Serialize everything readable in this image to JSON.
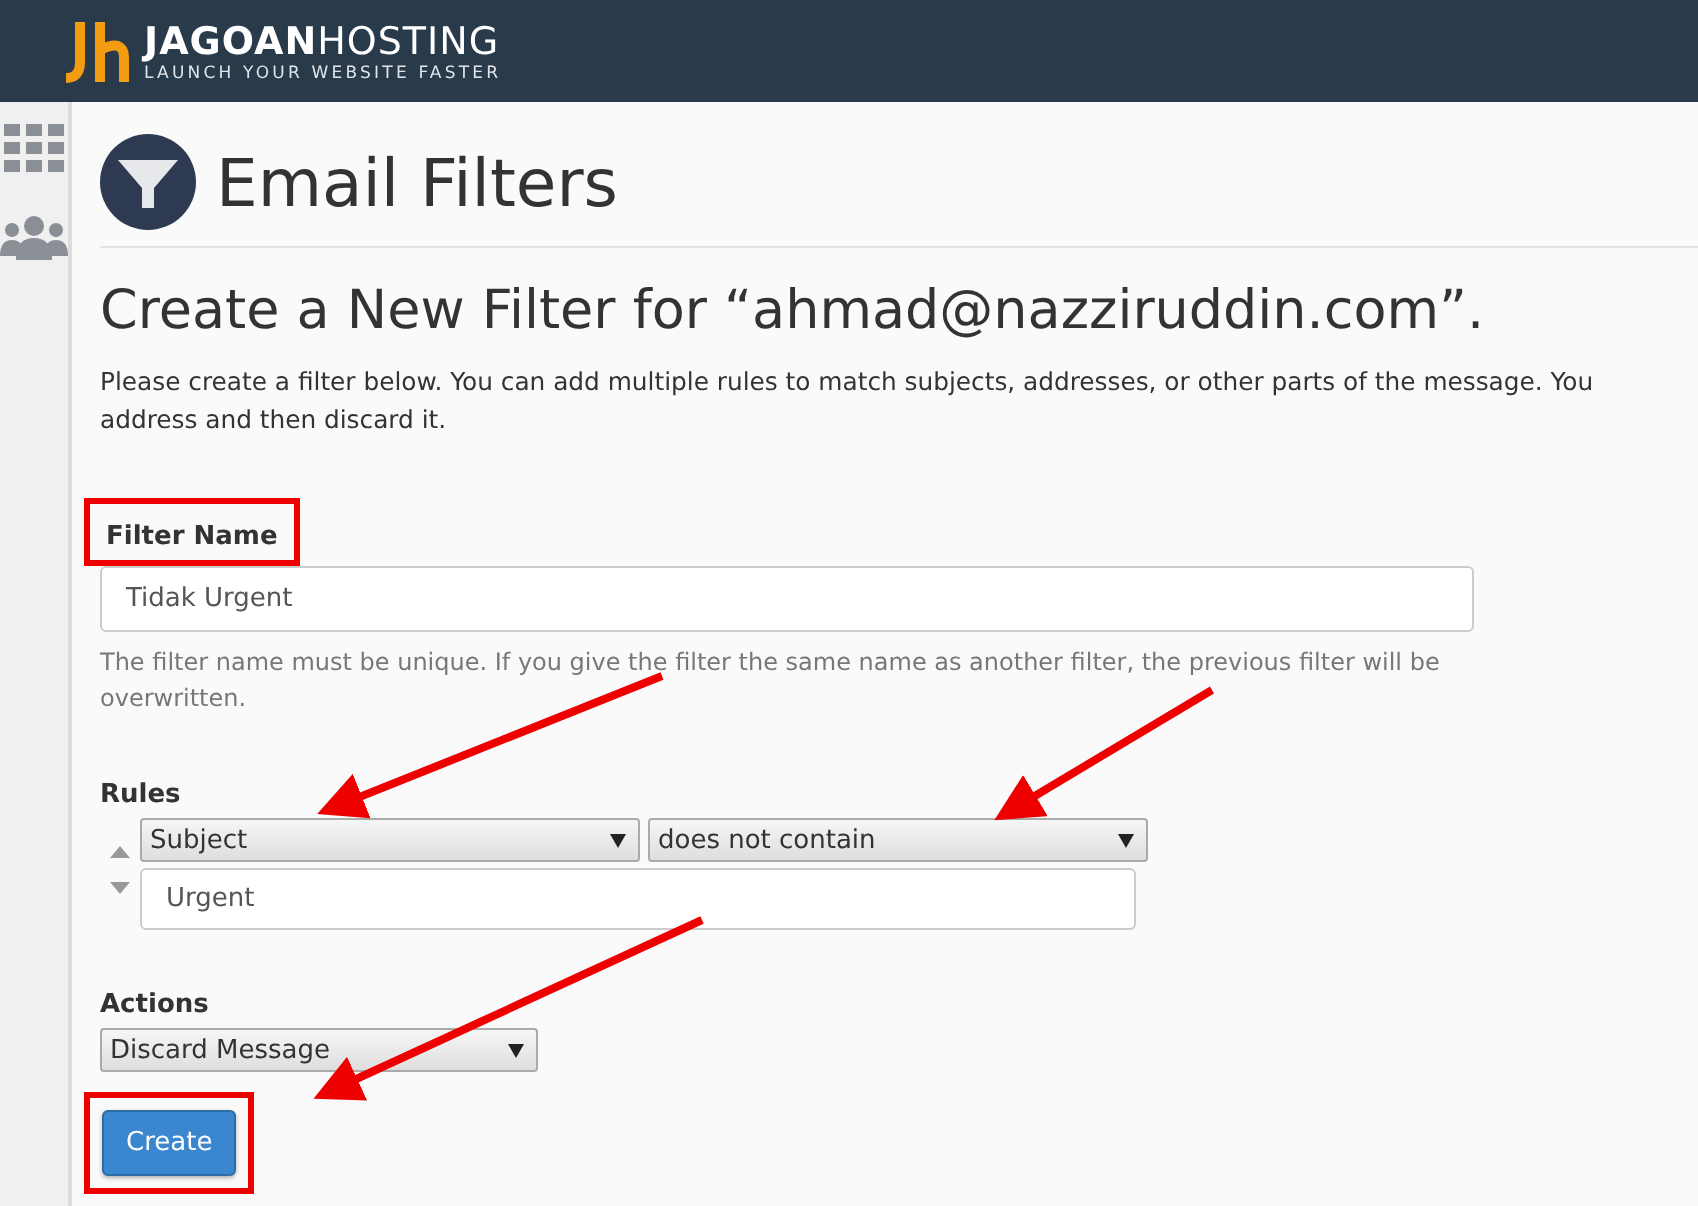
{
  "header": {
    "logo_name": "**JAGOAN**HOSTING",
    "tagline": "LAUNCH YOUR WEBSITE FASTER"
  },
  "page": {
    "title": "Email Filters"
  },
  "heading": "Create a New Filter for “ahmad@nazziruddin.com”.",
  "description": [
    "Please create a filter below. You can add multiple rules to match subjects, addresses, or other parts of the message. You",
    "address and then discard it."
  ],
  "filter_name": {
    "label": "Filter Name",
    "highlighted": true,
    "value": "Tidak Urgent",
    "help": "The filter name must be unique. If you give the filter the same name as another filter, the previous filter will be overwritten."
  },
  "rules": {
    "label": "Rules",
    "rows": [
      {
        "field": "Subject",
        "operator": "does not contain",
        "value": "Urgent"
      }
    ]
  },
  "actions": {
    "label": "Actions",
    "rows": [
      {
        "action": "Discard Message"
      }
    ]
  },
  "create_button": {
    "label": "Create",
    "highlighted": true
  }
}
